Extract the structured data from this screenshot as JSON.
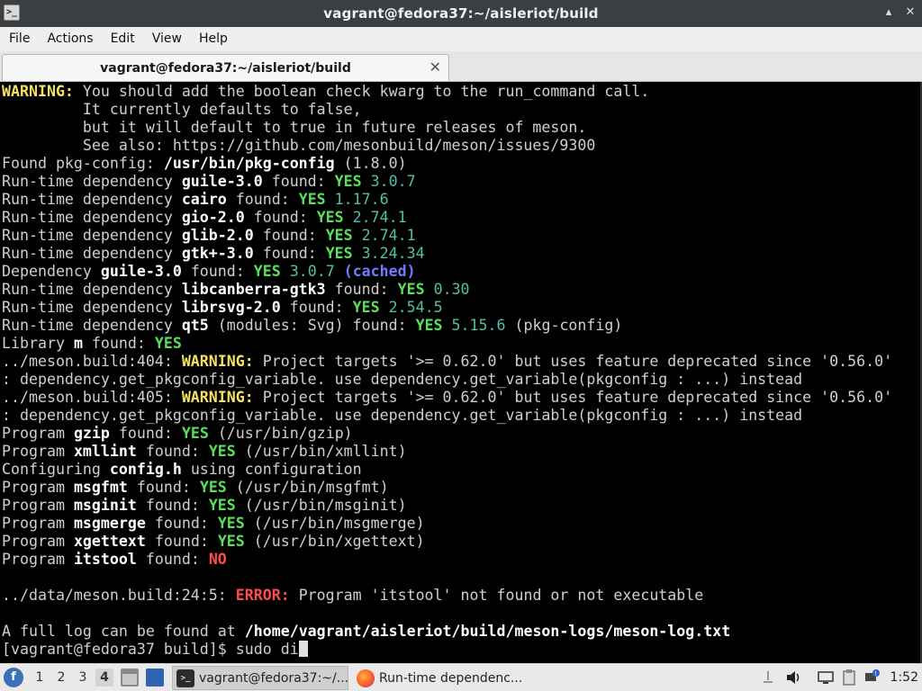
{
  "window": {
    "title": "vagrant@fedora37:~/aisleriot/build",
    "controls": [
      "▴",
      "✕"
    ]
  },
  "menu": [
    "File",
    "Actions",
    "Edit",
    "View",
    "Help"
  ],
  "tab": {
    "label": "vagrant@fedora37:~/aisleriot/build",
    "close": "✕"
  },
  "colors": {
    "title_bar": "#3c3f41",
    "terminal_bg": "#000000",
    "warning": "#f7e25b",
    "yes": "#58e05a",
    "version": "#53bfa9",
    "cached": "#6f7aff",
    "error": "#ff4b4b"
  },
  "terminal": {
    "lines": [
      [
        {
          "t": "WARNING:",
          "c": "y"
        },
        {
          "t": " You should add the boolean check kwarg to the run_command call."
        }
      ],
      [
        {
          "t": "         It currently defaults to false,"
        }
      ],
      [
        {
          "t": "         but it will default to true in future releases of meson."
        }
      ],
      [
        {
          "t": "         See also: https://github.com/mesonbuild/meson/issues/9300"
        }
      ],
      [
        {
          "t": "Found pkg-config: "
        },
        {
          "t": "/usr/bin/pkg-config",
          "c": "w"
        },
        {
          "t": " (1.8.0)"
        }
      ],
      [
        {
          "t": "Run-time dependency "
        },
        {
          "t": "guile-3.0",
          "c": "w"
        },
        {
          "t": " found: "
        },
        {
          "t": "YES",
          "c": "g"
        },
        {
          "t": " 3.0.7",
          "c": "v"
        }
      ],
      [
        {
          "t": "Run-time dependency "
        },
        {
          "t": "cairo",
          "c": "w"
        },
        {
          "t": " found: "
        },
        {
          "t": "YES",
          "c": "g"
        },
        {
          "t": " 1.17.6",
          "c": "v"
        }
      ],
      [
        {
          "t": "Run-time dependency "
        },
        {
          "t": "gio-2.0",
          "c": "w"
        },
        {
          "t": " found: "
        },
        {
          "t": "YES",
          "c": "g"
        },
        {
          "t": " 2.74.1",
          "c": "v"
        }
      ],
      [
        {
          "t": "Run-time dependency "
        },
        {
          "t": "glib-2.0",
          "c": "w"
        },
        {
          "t": " found: "
        },
        {
          "t": "YES",
          "c": "g"
        },
        {
          "t": " 2.74.1",
          "c": "v"
        }
      ],
      [
        {
          "t": "Run-time dependency "
        },
        {
          "t": "gtk+-3.0",
          "c": "w"
        },
        {
          "t": " found: "
        },
        {
          "t": "YES",
          "c": "g"
        },
        {
          "t": " 3.24.34",
          "c": "v"
        }
      ],
      [
        {
          "t": "Dependency "
        },
        {
          "t": "guile-3.0",
          "c": "w"
        },
        {
          "t": " found: "
        },
        {
          "t": "YES",
          "c": "g"
        },
        {
          "t": " 3.0.7",
          "c": "v"
        },
        {
          "t": " "
        },
        {
          "t": "(cached)",
          "c": "b"
        }
      ],
      [
        {
          "t": "Run-time dependency "
        },
        {
          "t": "libcanberra-gtk3",
          "c": "w"
        },
        {
          "t": " found: "
        },
        {
          "t": "YES",
          "c": "g"
        },
        {
          "t": " 0.30",
          "c": "v"
        }
      ],
      [
        {
          "t": "Run-time dependency "
        },
        {
          "t": "librsvg-2.0",
          "c": "w"
        },
        {
          "t": " found: "
        },
        {
          "t": "YES",
          "c": "g"
        },
        {
          "t": " 2.54.5",
          "c": "v"
        }
      ],
      [
        {
          "t": "Run-time dependency "
        },
        {
          "t": "qt5",
          "c": "w"
        },
        {
          "t": " (modules: Svg) found: "
        },
        {
          "t": "YES",
          "c": "g"
        },
        {
          "t": " 5.15.6",
          "c": "v"
        },
        {
          "t": " (pkg-config)"
        }
      ],
      [
        {
          "t": "Library "
        },
        {
          "t": "m",
          "c": "w"
        },
        {
          "t": " found: "
        },
        {
          "t": "YES",
          "c": "g"
        }
      ],
      [
        {
          "t": "../meson.build:404: "
        },
        {
          "t": "WARNING:",
          "c": "y"
        },
        {
          "t": " Project targets '>= 0.62.0' but uses feature deprecated since '0.56.0'"
        }
      ],
      [
        {
          "t": ": dependency.get_pkgconfig_variable. use dependency.get_variable(pkgconfig : ...) instead"
        }
      ],
      [
        {
          "t": "../meson.build:405: "
        },
        {
          "t": "WARNING:",
          "c": "y"
        },
        {
          "t": " Project targets '>= 0.62.0' but uses feature deprecated since '0.56.0'"
        }
      ],
      [
        {
          "t": ": dependency.get_pkgconfig_variable. use dependency.get_variable(pkgconfig : ...) instead"
        }
      ],
      [
        {
          "t": "Program "
        },
        {
          "t": "gzip",
          "c": "w"
        },
        {
          "t": " found: "
        },
        {
          "t": "YES",
          "c": "g"
        },
        {
          "t": " (/usr/bin/gzip)"
        }
      ],
      [
        {
          "t": "Program "
        },
        {
          "t": "xmllint",
          "c": "w"
        },
        {
          "t": " found: "
        },
        {
          "t": "YES",
          "c": "g"
        },
        {
          "t": " (/usr/bin/xmllint)"
        }
      ],
      [
        {
          "t": "Configuring "
        },
        {
          "t": "config.h",
          "c": "w"
        },
        {
          "t": " using configuration"
        }
      ],
      [
        {
          "t": "Program "
        },
        {
          "t": "msgfmt",
          "c": "w"
        },
        {
          "t": " found: "
        },
        {
          "t": "YES",
          "c": "g"
        },
        {
          "t": " (/usr/bin/msgfmt)"
        }
      ],
      [
        {
          "t": "Program "
        },
        {
          "t": "msginit",
          "c": "w"
        },
        {
          "t": " found: "
        },
        {
          "t": "YES",
          "c": "g"
        },
        {
          "t": " (/usr/bin/msginit)"
        }
      ],
      [
        {
          "t": "Program "
        },
        {
          "t": "msgmerge",
          "c": "w"
        },
        {
          "t": " found: "
        },
        {
          "t": "YES",
          "c": "g"
        },
        {
          "t": " (/usr/bin/msgmerge)"
        }
      ],
      [
        {
          "t": "Program "
        },
        {
          "t": "xgettext",
          "c": "w"
        },
        {
          "t": " found: "
        },
        {
          "t": "YES",
          "c": "g"
        },
        {
          "t": " (/usr/bin/xgettext)"
        }
      ],
      [
        {
          "t": "Program "
        },
        {
          "t": "itstool",
          "c": "w"
        },
        {
          "t": " found: "
        },
        {
          "t": "NO",
          "c": "r"
        }
      ],
      [],
      [
        {
          "t": "../data/meson.build:24:5: "
        },
        {
          "t": "ERROR:",
          "c": "r"
        },
        {
          "t": " Program 'itstool' not found or not executable"
        }
      ],
      [],
      [
        {
          "t": "A full log can be found at "
        },
        {
          "t": "/home/vagrant/aisleriot/build/meson-logs/meson-log.txt",
          "c": "w"
        }
      ],
      [
        {
          "t": "[vagrant@fedora37 build]$ sudo di"
        },
        {
          "t": "",
          "c": "cursor"
        }
      ]
    ]
  },
  "taskbar": {
    "start_icon": "fedora-start-icon",
    "workspaces": [
      "1",
      "2",
      "3",
      "4"
    ],
    "active_workspace": "4",
    "tasks": [
      {
        "label": "vagrant@fedora37:~/...",
        "icon": "terminal-icon"
      },
      {
        "label": "Run-time dependenc...",
        "icon": "firefox-icon"
      }
    ],
    "clock": "1:52"
  }
}
